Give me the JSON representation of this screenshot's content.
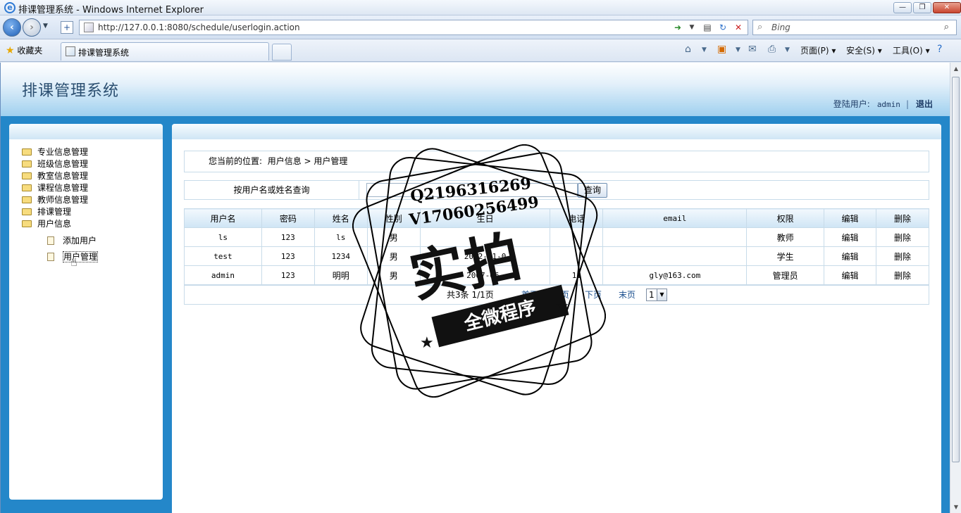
{
  "browser": {
    "window_title": "排课管理系统 - Windows Internet Explorer",
    "url": "http://127.0.0.1:8080/schedule/userlogin.action",
    "search_placeholder": "Bing",
    "favorites": "收藏夹",
    "tab_title": "排课管理系统",
    "menu_page": "页面(P)",
    "menu_safety": "安全(S)",
    "menu_tools": "工具(O)"
  },
  "app": {
    "title": "排课管理系统",
    "login_label": "登陆用户:",
    "login_user": "admin",
    "separator": "|",
    "logout": "退出"
  },
  "sidebar": {
    "items": [
      {
        "label": "专业信息管理"
      },
      {
        "label": "班级信息管理"
      },
      {
        "label": "教室信息管理"
      },
      {
        "label": "课程信息管理"
      },
      {
        "label": "教师信息管理"
      },
      {
        "label": "排课管理"
      },
      {
        "label": "用户信息"
      }
    ],
    "sub_items": [
      {
        "label": "添加用户"
      },
      {
        "label": "用户管理"
      }
    ]
  },
  "main": {
    "breadcrumb_prefix": "您当前的位置:",
    "breadcrumb_path": "用户信息 > 用户管理",
    "search_label": "按用户名或姓名查询",
    "search_value": "",
    "search_button": "查询",
    "columns": [
      "用户名",
      "密码",
      "姓名",
      "性别",
      "生日",
      "电话",
      "email",
      "权限",
      "编辑",
      "删除"
    ],
    "rows": [
      [
        "ls",
        "123",
        "ls",
        "男",
        "",
        "",
        "",
        "教师",
        "编辑",
        "删除"
      ],
      [
        "test",
        "123",
        "1234",
        "男",
        "2002-01-0",
        "",
        "",
        "学生",
        "编辑",
        "删除"
      ],
      [
        "admin",
        "123",
        "明明",
        "男",
        "2007-06-",
        "11",
        "gly@163.com",
        "管理员",
        "编辑",
        "删除"
      ]
    ],
    "pager": {
      "info": "共3条 1/1页",
      "first": "首页",
      "prev": "上页",
      "next": "下页",
      "last": "末页",
      "page_select": "1"
    }
  },
  "watermark": {
    "line1": "Q2196316269",
    "line2": "V17060256499",
    "big": "实拍",
    "ribbon": "全微程序"
  }
}
